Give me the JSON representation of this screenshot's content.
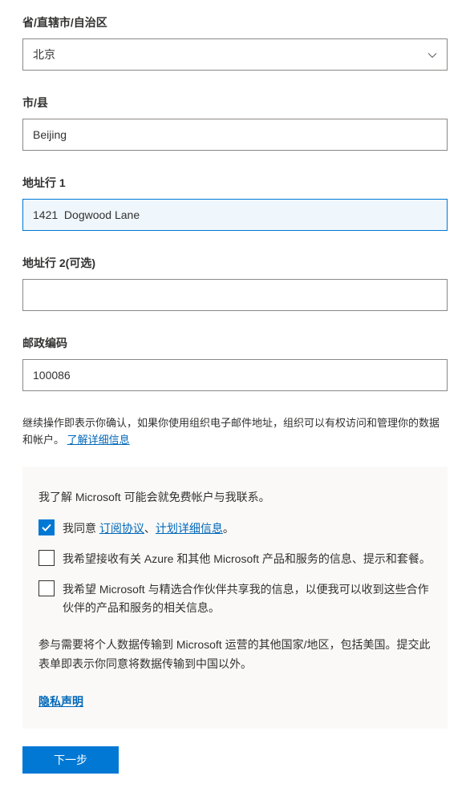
{
  "province": {
    "label": "省/直辖市/自治区",
    "value": "北京"
  },
  "city": {
    "label": "市/县",
    "value": "Beijing"
  },
  "address1": {
    "label": "地址行 1",
    "value": "1421  Dogwood Lane"
  },
  "address2": {
    "label": "地址行 2(可选)",
    "value": ""
  },
  "postal": {
    "label": "邮政编码",
    "value": "100086"
  },
  "disclaimer": {
    "text": "继续操作即表示你确认，如果你使用组织电子邮件地址，组织可以有权访问和管理你的数据和帐户。",
    "link": "了解详细信息"
  },
  "consent": {
    "heading": "我了解 Microsoft 可能会就免费帐户与我联系。",
    "agree": {
      "prefix": "我同意 ",
      "link1": "订阅协议",
      "sep": "、",
      "link2": "计划详细信息",
      "suffix": "。"
    },
    "azure": "我希望接收有关 Azure 和其他 Microsoft 产品和服务的信息、提示和套餐。",
    "partners": "我希望 Microsoft 与精选合作伙伴共享我的信息，以便我可以收到这些合作伙伴的产品和服务的相关信息。",
    "transfer": "参与需要将个人数据传输到 Microsoft 运营的其他国家/地区，包括美国。提交此表单即表示你同意将数据传输到中国以外。",
    "privacy": "隐私声明"
  },
  "nextButton": "下一步"
}
